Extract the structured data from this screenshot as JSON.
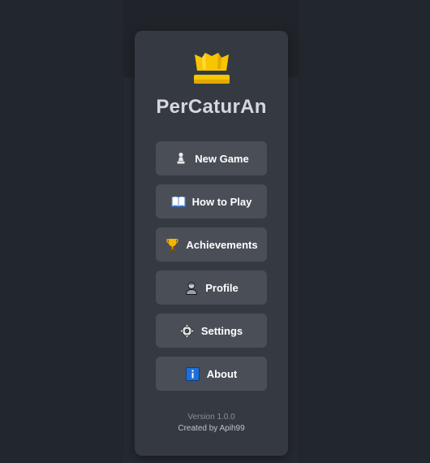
{
  "app": {
    "title": "PerCaturAn",
    "logo_icon": "crown-icon"
  },
  "menu": {
    "items": [
      {
        "label": "New Game",
        "icon": "pawn-icon"
      },
      {
        "label": "How to Play",
        "icon": "book-icon"
      },
      {
        "label": "Achievements",
        "icon": "trophy-icon"
      },
      {
        "label": "Profile",
        "icon": "user-icon"
      },
      {
        "label": "Settings",
        "icon": "gear-icon"
      },
      {
        "label": "About",
        "icon": "info-icon"
      }
    ]
  },
  "footer": {
    "version": "Version 1.0.0",
    "credit": "Created by Apih99"
  },
  "colors": {
    "background": "#22262d",
    "panel": "#353a42",
    "button": "#4a4f57",
    "accent": "#f5c518"
  }
}
